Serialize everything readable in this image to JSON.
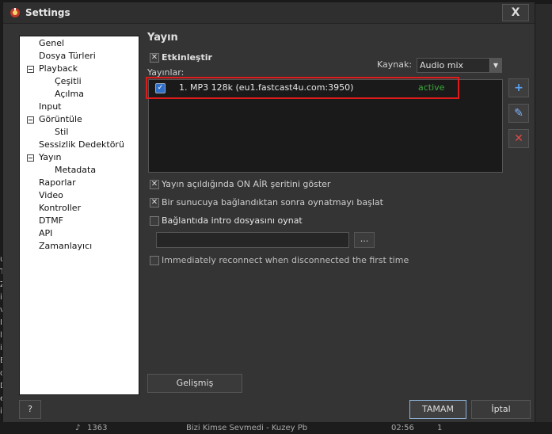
{
  "window": {
    "title": "Settings",
    "close_label": "X"
  },
  "tree": [
    {
      "label": "Genel",
      "level": 0,
      "expandable": false
    },
    {
      "label": "Dosya Türleri",
      "level": 0,
      "expandable": false
    },
    {
      "label": "Playback",
      "level": 0,
      "expandable": true
    },
    {
      "label": "Çeşitli",
      "level": 1,
      "expandable": false
    },
    {
      "label": "Açılma",
      "level": 1,
      "expandable": false
    },
    {
      "label": "Input",
      "level": 0,
      "expandable": false
    },
    {
      "label": "Görüntüle",
      "level": 0,
      "expandable": true
    },
    {
      "label": "Stil",
      "level": 1,
      "expandable": false
    },
    {
      "label": "Sessizlik Dedektörü",
      "level": 0,
      "expandable": false
    },
    {
      "label": "Yayın",
      "level": 0,
      "expandable": true,
      "selected": true
    },
    {
      "label": "Metadata",
      "level": 1,
      "expandable": false
    },
    {
      "label": "Raporlar",
      "level": 0,
      "expandable": false
    },
    {
      "label": "Video",
      "level": 0,
      "expandable": false
    },
    {
      "label": "Kontroller",
      "level": 0,
      "expandable": false
    },
    {
      "label": "DTMF",
      "level": 0,
      "expandable": false
    },
    {
      "label": "API",
      "level": 0,
      "expandable": false
    },
    {
      "label": "Zamanlayıcı",
      "level": 0,
      "expandable": false
    }
  ],
  "panel": {
    "title": "Yayın",
    "enable_label": "Etkinleştir",
    "enable_checked": true,
    "source_label": "Kaynak:",
    "source_value": "Audio mix",
    "streams_label": "Yayınlar:",
    "streams": [
      {
        "name": "1. MP3 128k (eu1.fastcast4u.com:3950)",
        "status": "active",
        "checked": true
      }
    ],
    "options": [
      {
        "label": "Yayın açıldığında ON AİR şeritini göster",
        "checked": true
      },
      {
        "label": "Bir sunucuya bağlandıktan sonra oynatmayı başlat",
        "checked": true
      },
      {
        "label": "Bağlantıda intro dosyasını oynat",
        "checked": false
      },
      {
        "label": "Immediately reconnect when disconnected the first time",
        "checked": false
      }
    ],
    "intro_file_value": "",
    "browse_label": "...",
    "advanced_label": "Gelişmiş"
  },
  "buttons": {
    "help": "?",
    "ok": "TAMAM",
    "cancel": "İptal"
  },
  "side_buttons": {
    "add": "+",
    "edit": "✎",
    "remove": "✕"
  },
  "background": {
    "left_chars": [
      "u",
      "T",
      "Z",
      "i",
      "v",
      "I",
      "l",
      "i",
      "E",
      "o",
      "D",
      "e",
      "i"
    ],
    "bottom": {
      "num": "1363",
      "title": "Bizi Kimse Sevmedi - Kuzey Pb",
      "time": "02:56",
      "count": "1"
    }
  },
  "colors": {
    "accent": "#2f6fc8",
    "active": "#3aa83a",
    "highlight": "#e01b1b"
  }
}
